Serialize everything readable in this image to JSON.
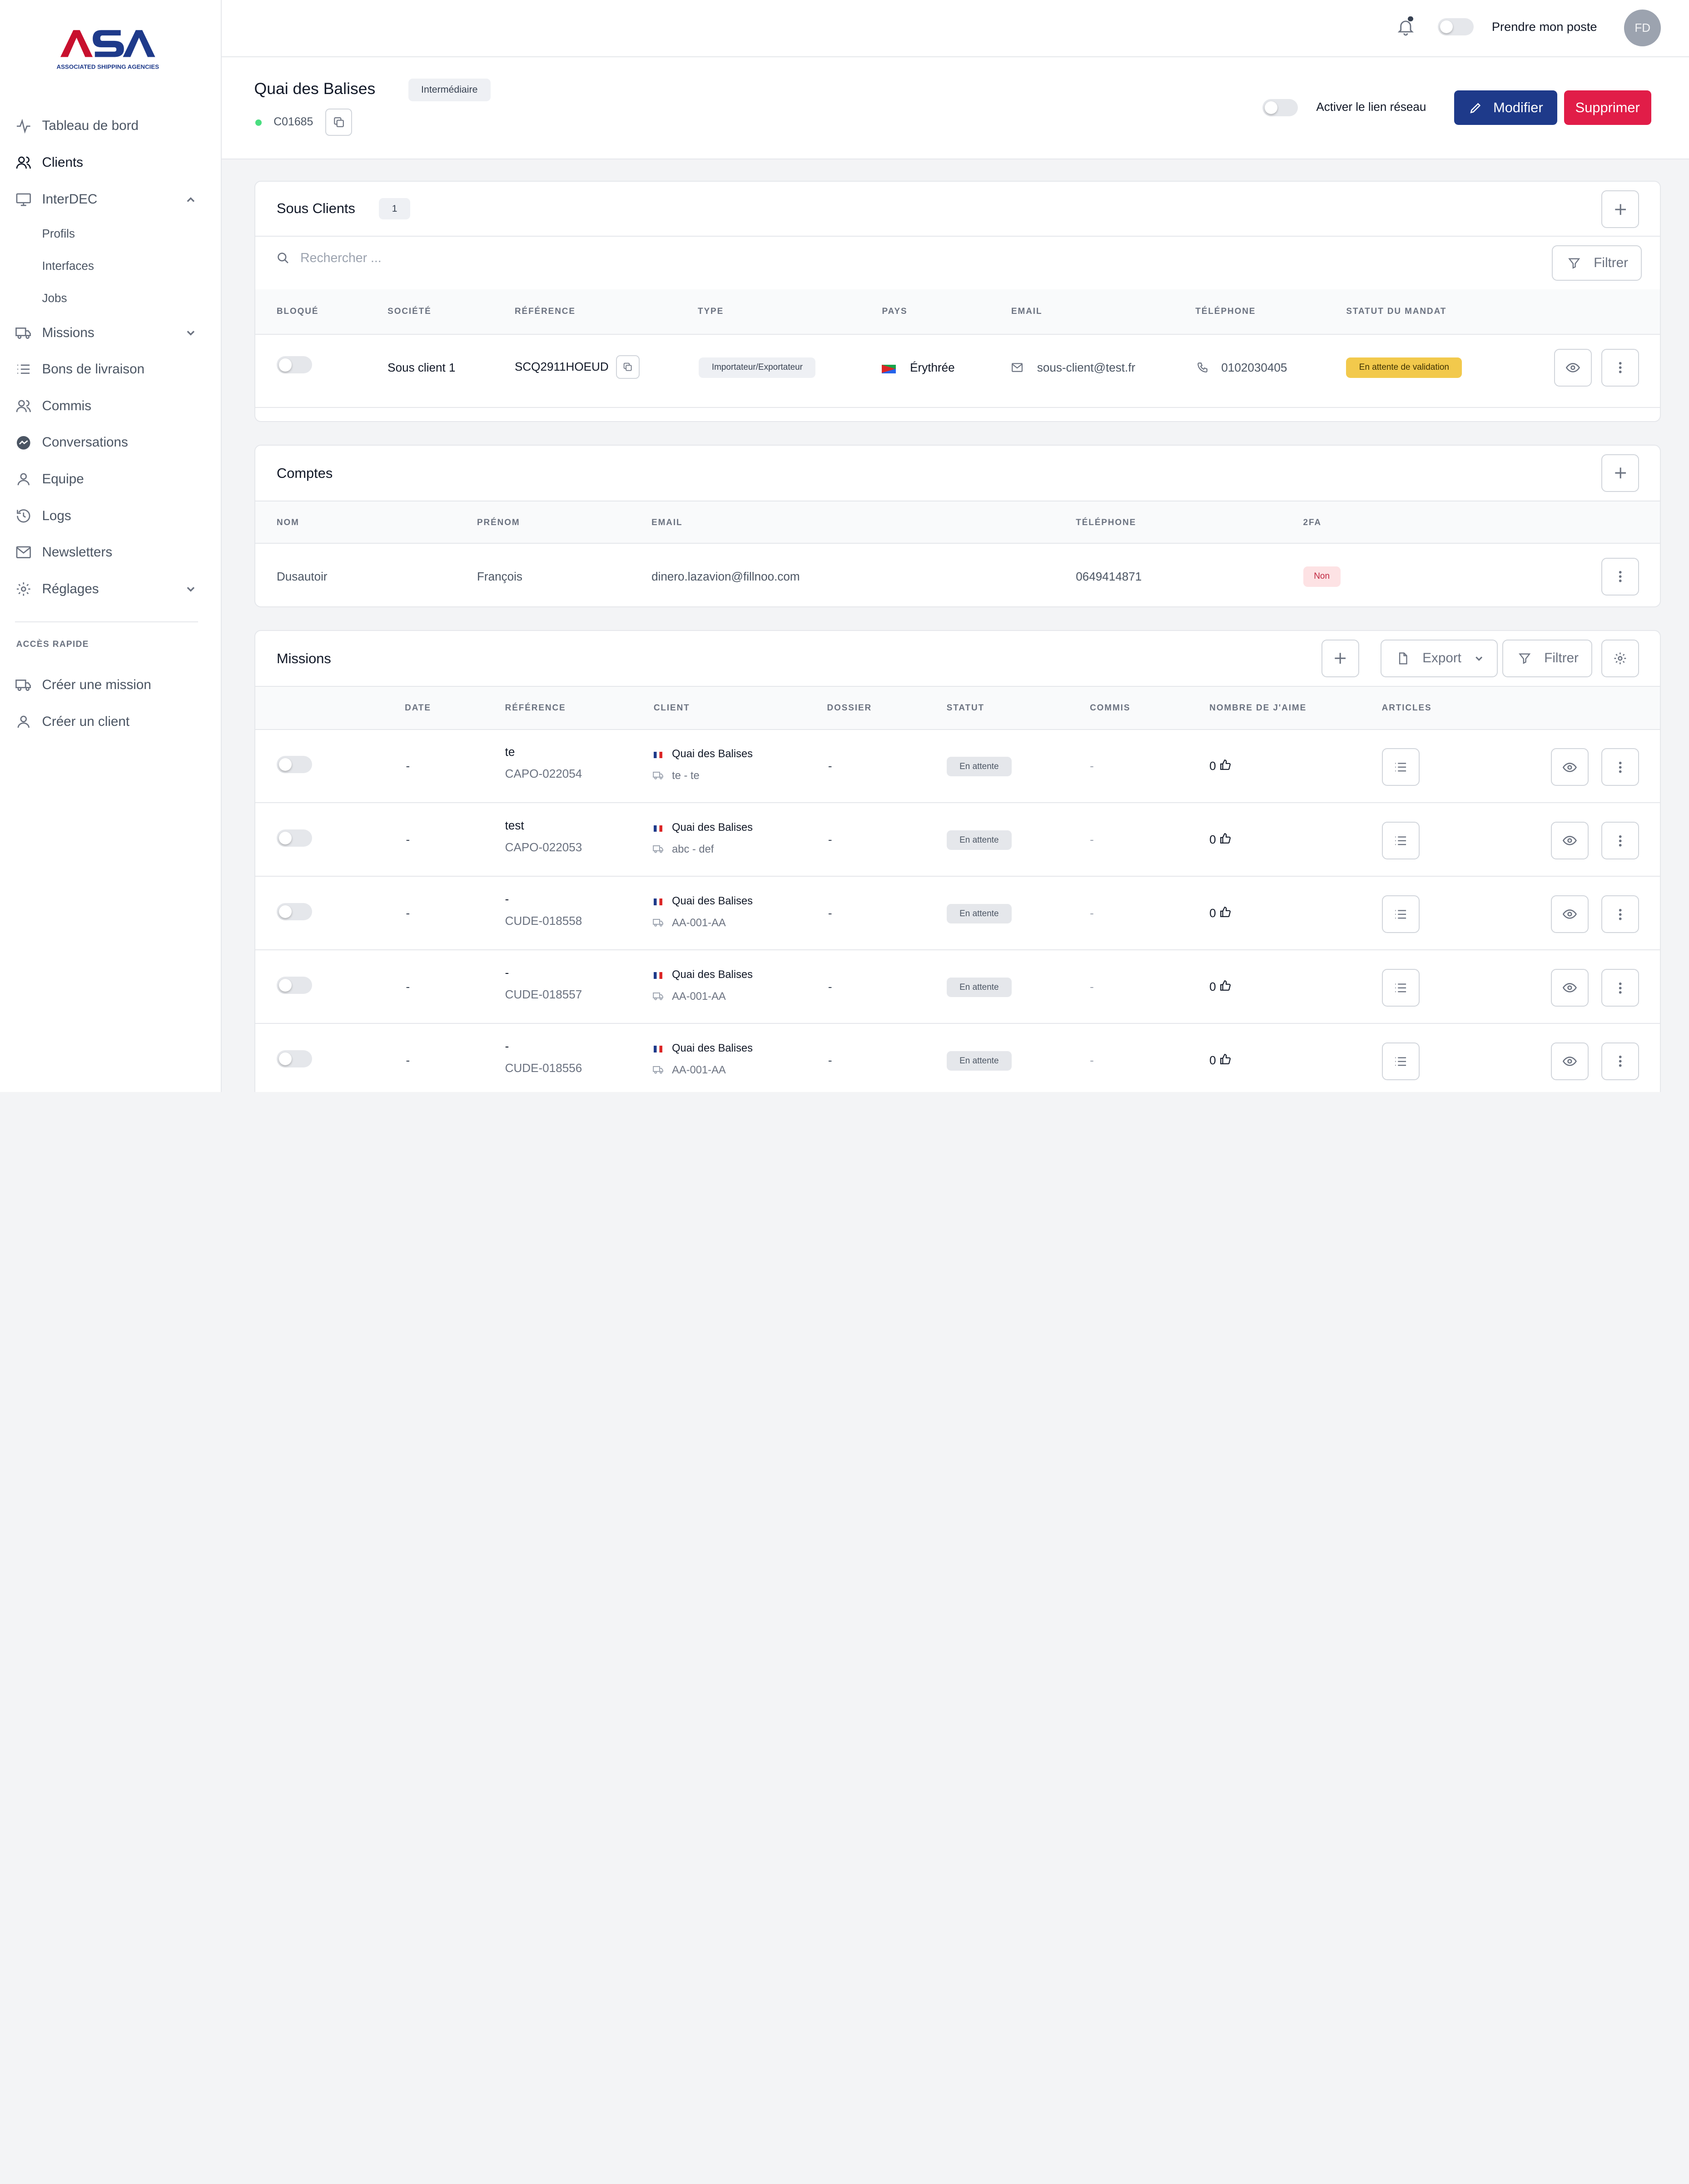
{
  "brand": {
    "logo_text": "ASA",
    "logo_sub": "ASSOCIATED SHIPPING AGENCIES"
  },
  "sidebar": {
    "items": [
      {
        "label": "Tableau de bord",
        "icon": "activity-icon"
      },
      {
        "label": "Clients",
        "icon": "users-icon",
        "active": true
      },
      {
        "label": "InterDEC",
        "icon": "monitor-icon",
        "expanded": true
      },
      {
        "label": "Missions",
        "icon": "truck-icon"
      },
      {
        "label": "Bons de livraison",
        "icon": "list-icon"
      },
      {
        "label": "Commis",
        "icon": "users-icon"
      },
      {
        "label": "Conversations",
        "icon": "messenger-icon"
      },
      {
        "label": "Equipe",
        "icon": "user-icon"
      },
      {
        "label": "Logs",
        "icon": "history-icon"
      },
      {
        "label": "Newsletters",
        "icon": "mail-icon"
      },
      {
        "label": "Réglages",
        "icon": "gear-icon"
      }
    ],
    "interdec_sub": [
      "Profils",
      "Interfaces",
      "Jobs"
    ],
    "quick_title": "ACCÈS RAPIDE",
    "quick": [
      "Créer une mission",
      "Créer un client"
    ]
  },
  "topbar": {
    "shift_label": "Prendre mon poste",
    "avatar": "FD"
  },
  "header": {
    "title": "Quai des Balises",
    "badge": "Intermédiaire",
    "code": "C01685",
    "network_label": "Activer le lien réseau",
    "edit_label": "Modifier",
    "delete_label": "Supprimer"
  },
  "sous_clients": {
    "title": "Sous Clients",
    "count": "1",
    "search_placeholder": "Rechercher ...",
    "filter_label": "Filtrer",
    "columns": [
      "BLOQUÉ",
      "SOCIÉTÉ",
      "RÉFÉRENCE",
      "TYPE",
      "PAYS",
      "EMAIL",
      "TÉLÉPHONE",
      "STATUT DU MANDAT"
    ],
    "row": {
      "societe": "Sous client 1",
      "reference": "SCQ2911HOEUD",
      "type": "Importateur/Exportateur",
      "pays": "Érythrée",
      "email": "sous-client@test.fr",
      "telephone": "0102030405",
      "statut": "En attente de validation"
    }
  },
  "comptes": {
    "title": "Comptes",
    "columns": [
      "NOM",
      "PRÉNOM",
      "EMAIL",
      "TÉLÉPHONE",
      "2FA"
    ],
    "row": {
      "nom": "Dusautoir",
      "prenom": "François",
      "email": "dinero.lazavion@fillnoo.com",
      "telephone": "0649414871",
      "twofa": "Non"
    }
  },
  "missions": {
    "title": "Missions",
    "export_label": "Export",
    "filter_label": "Filtrer",
    "columns": [
      "DATE",
      "RÉFÉRENCE",
      "CLIENT",
      "DOSSIER",
      "STATUT",
      "COMMIS",
      "NOMBRE DE J'AIME",
      "ARTICLES"
    ],
    "rows": [
      {
        "date": "-",
        "ref_top": "te",
        "ref": "CAPO-022054",
        "client": "Quai des Balises",
        "vehicle": "te - te",
        "dossier": "-",
        "statut": "En attente",
        "commis": "-",
        "likes": "0"
      },
      {
        "date": "-",
        "ref_top": "test",
        "ref": "CAPO-022053",
        "client": "Quai des Balises",
        "vehicle": "abc - def",
        "dossier": "-",
        "statut": "En attente",
        "commis": "-",
        "likes": "0"
      },
      {
        "date": "-",
        "ref_top": "-",
        "ref": "CUDE-018558",
        "client": "Quai des Balises",
        "vehicle": "AA-001-AA",
        "dossier": "-",
        "statut": "En attente",
        "commis": "-",
        "likes": "0"
      },
      {
        "date": "-",
        "ref_top": "-",
        "ref": "CUDE-018557",
        "client": "Quai des Balises",
        "vehicle": "AA-001-AA",
        "dossier": "-",
        "statut": "En attente",
        "commis": "-",
        "likes": "0"
      },
      {
        "date": "-",
        "ref_top": "-",
        "ref": "CUDE-018556",
        "client": "Quai des Balises",
        "vehicle": "AA-001-AA",
        "dossier": "-",
        "statut": "En attente",
        "commis": "-",
        "likes": "0"
      }
    ]
  },
  "colors": {
    "primary": "#1e3a8a",
    "danger": "#e11d48",
    "warning": "#f2c94c",
    "online": "#4ade80"
  }
}
